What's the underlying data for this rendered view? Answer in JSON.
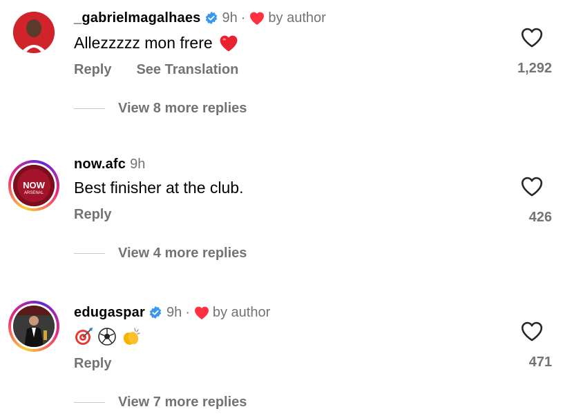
{
  "comments": [
    {
      "username": "_gabrielmagalhaes",
      "verified": true,
      "time": "9h",
      "liked_by_author": true,
      "by_author_label": "by author",
      "text": "Allezzzzz mon frere",
      "text_emoji": "red-heart",
      "reply_label": "Reply",
      "translate_label": "See Translation",
      "like_count": "1,292",
      "view_replies": "View 8 more replies"
    },
    {
      "username": "now.afc",
      "verified": false,
      "time": "9h",
      "liked_by_author": false,
      "text": "Best finisher at the club.",
      "reply_label": "Reply",
      "like_count": "426",
      "view_replies": "View 4 more replies",
      "avatar_logo_text": "NOW",
      "avatar_logo_sub": "ARSENAL"
    },
    {
      "username": "edugaspar",
      "verified": true,
      "time": "9h",
      "liked_by_author": true,
      "by_author_label": "by author",
      "text_emojis": [
        "direct-hit",
        "soccer-ball",
        "clapping-hands"
      ],
      "reply_label": "Reply",
      "like_count": "471",
      "view_replies": "View 7 more replies"
    }
  ],
  "colors": {
    "secondary_text": "#737373",
    "verified_blue": "#3897f0",
    "heart_red": "#ff3040",
    "divider": "#c7c7c7"
  }
}
